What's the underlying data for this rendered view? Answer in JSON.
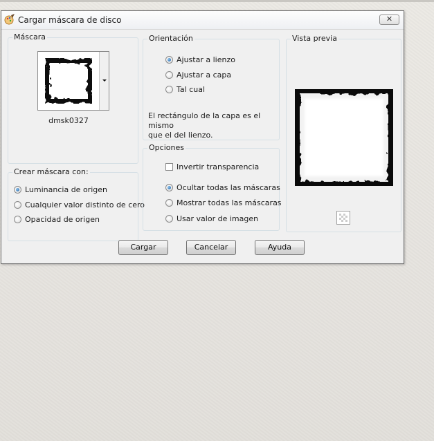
{
  "dialog": {
    "title": "Cargar máscara de disco",
    "close_symbol": "✕"
  },
  "mask_group": {
    "legend": "Máscara",
    "mask_name": "dmsk0327"
  },
  "create_group": {
    "legend": "Crear máscara con:",
    "options": [
      {
        "label": "Luminancia de origen",
        "selected": true
      },
      {
        "label": "Cualquier valor distinto de cero",
        "selected": false
      },
      {
        "label": "Opacidad de origen",
        "selected": false
      }
    ]
  },
  "orientation_group": {
    "legend": "Orientación",
    "options": [
      {
        "label": "Ajustar a lienzo",
        "selected": true
      },
      {
        "label": "Ajustar a capa",
        "selected": false
      },
      {
        "label": "Tal cual",
        "selected": false
      }
    ],
    "info_line1": "El rectángulo de la capa es el mismo",
    "info_line2": "que el del lienzo."
  },
  "options_group": {
    "legend": "Opciones",
    "invert_label": "Invertir transparencia",
    "invert_checked": false,
    "options": [
      {
        "label": "Ocultar todas las máscaras",
        "selected": true
      },
      {
        "label": "Mostrar todas las máscaras",
        "selected": false
      },
      {
        "label": "Usar valor de imagen",
        "selected": false
      }
    ]
  },
  "preview_group": {
    "legend": "Vista previa"
  },
  "buttons": {
    "load": "Cargar",
    "cancel": "Cancelar",
    "help": "Ayuda"
  },
  "icons": {
    "app": "psp-brush-icon",
    "close": "close-icon",
    "dropdown": "chevron-down-icon",
    "transparency": "checkerboard-icon"
  }
}
